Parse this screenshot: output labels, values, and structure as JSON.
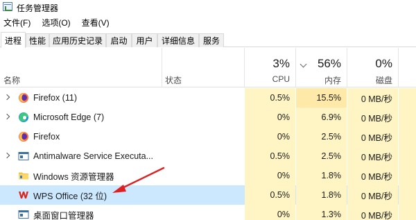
{
  "window": {
    "title": "任务管理器"
  },
  "menu": [
    "文件(F)",
    "选项(O)",
    "查看(V)"
  ],
  "tabs": [
    {
      "label": "进程",
      "active": true
    },
    {
      "label": "性能",
      "active": false
    },
    {
      "label": "应用历史记录",
      "active": false
    },
    {
      "label": "启动",
      "active": false
    },
    {
      "label": "用户",
      "active": false
    },
    {
      "label": "详细信息",
      "active": false
    },
    {
      "label": "服务",
      "active": false
    }
  ],
  "header": {
    "name": "名称",
    "status": "状态",
    "cpu": {
      "pct": "3%",
      "label": "CPU"
    },
    "mem": {
      "pct": "56%",
      "label": "内存"
    },
    "disk": {
      "pct": "0%",
      "label": "磁盘"
    }
  },
  "processes": [
    {
      "name": "Firefox (11)",
      "icon": "firefox-icon",
      "expandable": true,
      "cpu": "0.5%",
      "mem": "15.5%",
      "disk": "0 MB/秒",
      "selected": false
    },
    {
      "name": "Microsoft Edge (7)",
      "icon": "edge-icon",
      "expandable": true,
      "cpu": "0%",
      "mem": "6.9%",
      "disk": "0 MB/秒",
      "selected": false
    },
    {
      "name": "Firefox",
      "icon": "firefox-icon",
      "expandable": false,
      "cpu": "0%",
      "mem": "2.5%",
      "disk": "0 MB/秒",
      "selected": false
    },
    {
      "name": "Antimalware Service Executa...",
      "icon": "service-window-icon",
      "expandable": true,
      "cpu": "0.5%",
      "mem": "2.5%",
      "disk": "0 MB/秒",
      "selected": false
    },
    {
      "name": "Windows 资源管理器",
      "icon": "folder-icon",
      "expandable": false,
      "cpu": "0%",
      "mem": "1.8%",
      "disk": "0 MB/秒",
      "selected": false
    },
    {
      "name": "WPS Office (32 位)",
      "icon": "wps-icon",
      "expandable": false,
      "cpu": "0.5%",
      "mem": "1.8%",
      "disk": "0 MB/秒",
      "selected": true
    },
    {
      "name": "桌面窗口管理器",
      "icon": "service-window-icon",
      "expandable": false,
      "cpu": "0%",
      "mem": "1.3%",
      "disk": "0 MB/秒",
      "selected": false
    }
  ],
  "colors": {
    "selected_row": "#cce8ff",
    "heat_light": "#fff4c4",
    "heat_medium": "#ffe9a8",
    "annotation_arrow": "#e02020"
  }
}
